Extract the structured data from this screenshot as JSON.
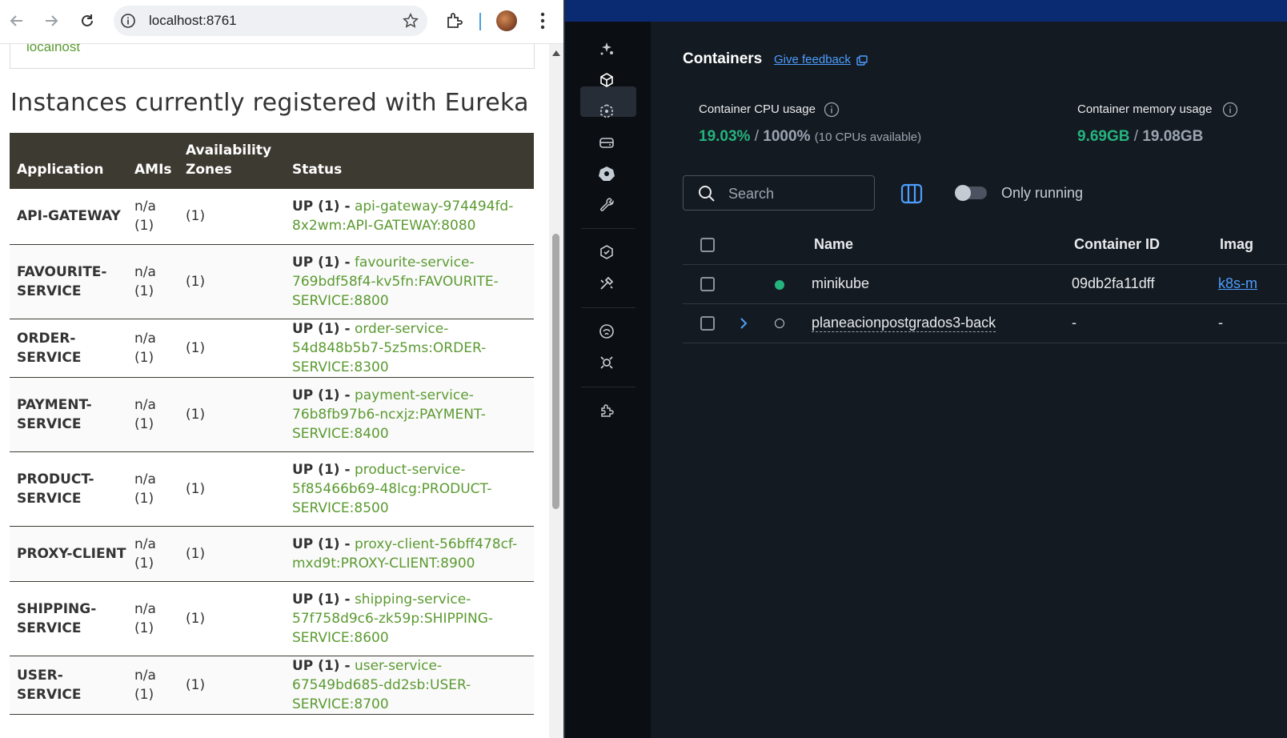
{
  "browser": {
    "url": "localhost:8761"
  },
  "eureka": {
    "prev_section_text": "localhost",
    "heading": "Instances currently registered with Eureka",
    "columns": [
      "Application",
      "AMIs",
      "Availability Zones",
      "Status"
    ],
    "rows": [
      {
        "app": "API-GATEWAY",
        "amis": "n/a (1)",
        "zones": "(1)",
        "status": "UP (1) -",
        "instance": "api-gateway-974494fd-8x2wm:API-GATEWAY:8080"
      },
      {
        "app": "FAVOURITE-SERVICE",
        "amis": "n/a (1)",
        "zones": "(1)",
        "status": "UP (1) -",
        "instance": "favourite-service-769bdf58f4-kv5fn:FAVOURITE-SERVICE:8800"
      },
      {
        "app": "ORDER-SERVICE",
        "amis": "n/a (1)",
        "zones": "(1)",
        "status": "UP (1) -",
        "instance": "order-service-54d848b5b7-5z5ms:ORDER-SERVICE:8300"
      },
      {
        "app": "PAYMENT-SERVICE",
        "amis": "n/a (1)",
        "zones": "(1)",
        "status": "UP (1) -",
        "instance": "payment-service-76b8fb97b6-ncxjz:PAYMENT-SERVICE:8400"
      },
      {
        "app": "PRODUCT-SERVICE",
        "amis": "n/a (1)",
        "zones": "(1)",
        "status": "UP (1) -",
        "instance": "product-service-5f85466b69-48lcg:PRODUCT-SERVICE:8500"
      },
      {
        "app": "PROXY-CLIENT",
        "amis": "n/a (1)",
        "zones": "(1)",
        "status": "UP (1) -",
        "instance": "proxy-client-56bff478cf-mxd9t:PROXY-CLIENT:8900"
      },
      {
        "app": "SHIPPING-SERVICE",
        "amis": "n/a (1)",
        "zones": "(1)",
        "status": "UP (1) -",
        "instance": "shipping-service-57f758d9c6-zk59p:SHIPPING-SERVICE:8600"
      },
      {
        "app": "USER-SERVICE",
        "amis": "n/a (1)",
        "zones": "(1)",
        "status": "UP (1) -",
        "instance": "user-service-67549bd685-dd2sb:USER-SERVICE:8700"
      }
    ],
    "link_color": "#5b9a31",
    "header_bg": "#3d3a31"
  },
  "docker": {
    "title": "Containers",
    "feedback_label": "Give feedback",
    "cpu": {
      "label": "Container CPU usage",
      "used": "19.03%",
      "sep": "/",
      "total": "1000%",
      "note": "(10 CPUs available)"
    },
    "memory": {
      "label": "Container memory usage",
      "used": "9.69GB",
      "sep": "/",
      "total": "19.08GB"
    },
    "search_placeholder": "Search",
    "only_running_label": "Only running",
    "columns": {
      "name": "Name",
      "id": "Container ID",
      "image": "Imag"
    },
    "containers": [
      {
        "name": "minikube",
        "id": "09db2fa11dff",
        "image": "k8s-m",
        "state": "running"
      },
      {
        "name": "planeacionpostgrados3-back",
        "id": "-",
        "image": "-",
        "state": "stopped"
      }
    ],
    "sidebar_icons": [
      "gordon-icon",
      "containers-icon",
      "images-icon",
      "volumes-icon",
      "kubernetes-icon",
      "dev-tools-icon",
      "scout-icon",
      "builds-icon",
      "extensions-marketplace-icon",
      "extension-icon",
      "add-extension-icon"
    ],
    "accent_green": "#24b47e",
    "accent_blue": "#4d9eff"
  }
}
